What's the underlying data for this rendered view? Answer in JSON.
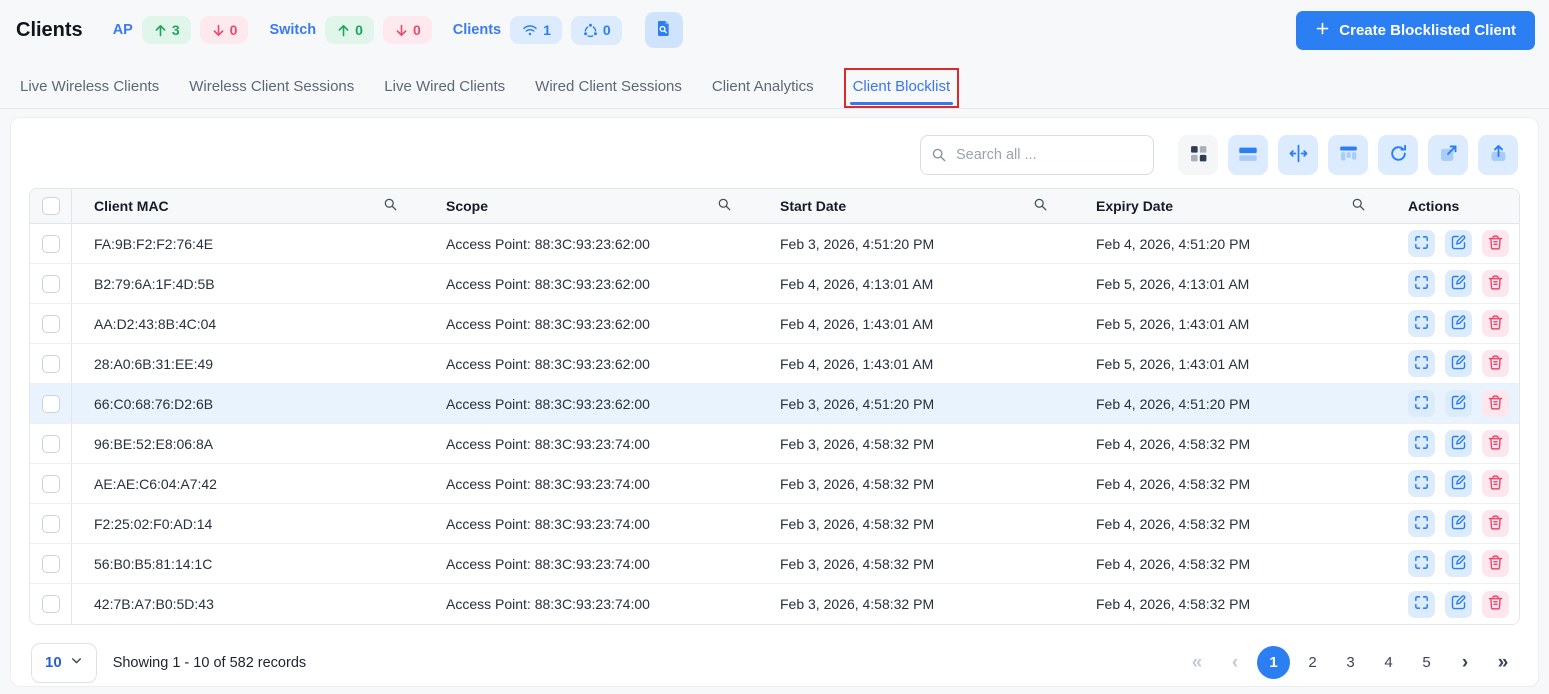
{
  "header": {
    "title": "Clients",
    "create_button_label": "Create Blocklisted Client",
    "stats": {
      "ap_label": "AP",
      "ap_up": "3",
      "ap_down": "0",
      "switch_label": "Switch",
      "switch_up": "0",
      "switch_down": "0",
      "clients_label": "Clients",
      "clients_wireless": "1",
      "clients_mesh": "0"
    }
  },
  "tabs": [
    {
      "label": "Live Wireless Clients"
    },
    {
      "label": "Wireless Client Sessions"
    },
    {
      "label": "Live Wired Clients"
    },
    {
      "label": "Wired Client Sessions"
    },
    {
      "label": "Client Analytics"
    },
    {
      "label": "Client Blocklist"
    }
  ],
  "active_tab": "Client Blocklist",
  "toolbar": {
    "search_placeholder": "Search all ...",
    "icons": [
      "card-view",
      "list-view",
      "column-width",
      "column-picker",
      "refresh",
      "open-in-new",
      "export"
    ]
  },
  "table": {
    "columns": [
      "Client MAC",
      "Scope",
      "Start Date",
      "Expiry Date",
      "Actions"
    ],
    "rows": [
      {
        "mac": "FA:9B:F2:F2:76:4E",
        "scope": "Access Point: 88:3C:93:23:62:00",
        "start": "Feb 3, 2026, 4:51:20 PM",
        "expiry": "Feb 4, 2026, 4:51:20 PM",
        "highlighted": false
      },
      {
        "mac": "B2:79:6A:1F:4D:5B",
        "scope": "Access Point: 88:3C:93:23:62:00",
        "start": "Feb 4, 2026, 4:13:01 AM",
        "expiry": "Feb 5, 2026, 4:13:01 AM",
        "highlighted": false
      },
      {
        "mac": "AA:D2:43:8B:4C:04",
        "scope": "Access Point: 88:3C:93:23:62:00",
        "start": "Feb 4, 2026, 1:43:01 AM",
        "expiry": "Feb 5, 2026, 1:43:01 AM",
        "highlighted": false
      },
      {
        "mac": "28:A0:6B:31:EE:49",
        "scope": "Access Point: 88:3C:93:23:62:00",
        "start": "Feb 4, 2026, 1:43:01 AM",
        "expiry": "Feb 5, 2026, 1:43:01 AM",
        "highlighted": false
      },
      {
        "mac": "66:C0:68:76:D2:6B",
        "scope": "Access Point: 88:3C:93:23:62:00",
        "start": "Feb 3, 2026, 4:51:20 PM",
        "expiry": "Feb 4, 2026, 4:51:20 PM",
        "highlighted": true
      },
      {
        "mac": "96:BE:52:E8:06:8A",
        "scope": "Access Point: 88:3C:93:23:74:00",
        "start": "Feb 3, 2026, 4:58:32 PM",
        "expiry": "Feb 4, 2026, 4:58:32 PM",
        "highlighted": false
      },
      {
        "mac": "AE:AE:C6:04:A7:42",
        "scope": "Access Point: 88:3C:93:23:74:00",
        "start": "Feb 3, 2026, 4:58:32 PM",
        "expiry": "Feb 4, 2026, 4:58:32 PM",
        "highlighted": false
      },
      {
        "mac": "F2:25:02:F0:AD:14",
        "scope": "Access Point: 88:3C:93:23:74:00",
        "start": "Feb 3, 2026, 4:58:32 PM",
        "expiry": "Feb 4, 2026, 4:58:32 PM",
        "highlighted": false
      },
      {
        "mac": "56:B0:B5:81:14:1C",
        "scope": "Access Point: 88:3C:93:23:74:00",
        "start": "Feb 3, 2026, 4:58:32 PM",
        "expiry": "Feb 4, 2026, 4:58:32 PM",
        "highlighted": false
      },
      {
        "mac": "42:7B:A7:B0:5D:43",
        "scope": "Access Point: 88:3C:93:23:74:00",
        "start": "Feb 3, 2026, 4:58:32 PM",
        "expiry": "Feb 4, 2026, 4:58:32 PM",
        "highlighted": false
      }
    ],
    "row_actions": [
      "expand",
      "edit",
      "delete"
    ]
  },
  "footer": {
    "page_size": "10",
    "showing": "Showing 1 - 10 of 582 records",
    "pages": [
      "1",
      "2",
      "3",
      "4",
      "5"
    ],
    "active_page": "1",
    "first_glyph": "«",
    "prev_glyph": "‹",
    "next_glyph": "›",
    "last_glyph": "»"
  },
  "colors": {
    "accent_blue": "#2b7ff3",
    "badge_green": "#1fa45b",
    "badge_red": "#e84a6f",
    "annotation_red": "#da2a2a",
    "highlight_row": "#e9f3fd"
  }
}
